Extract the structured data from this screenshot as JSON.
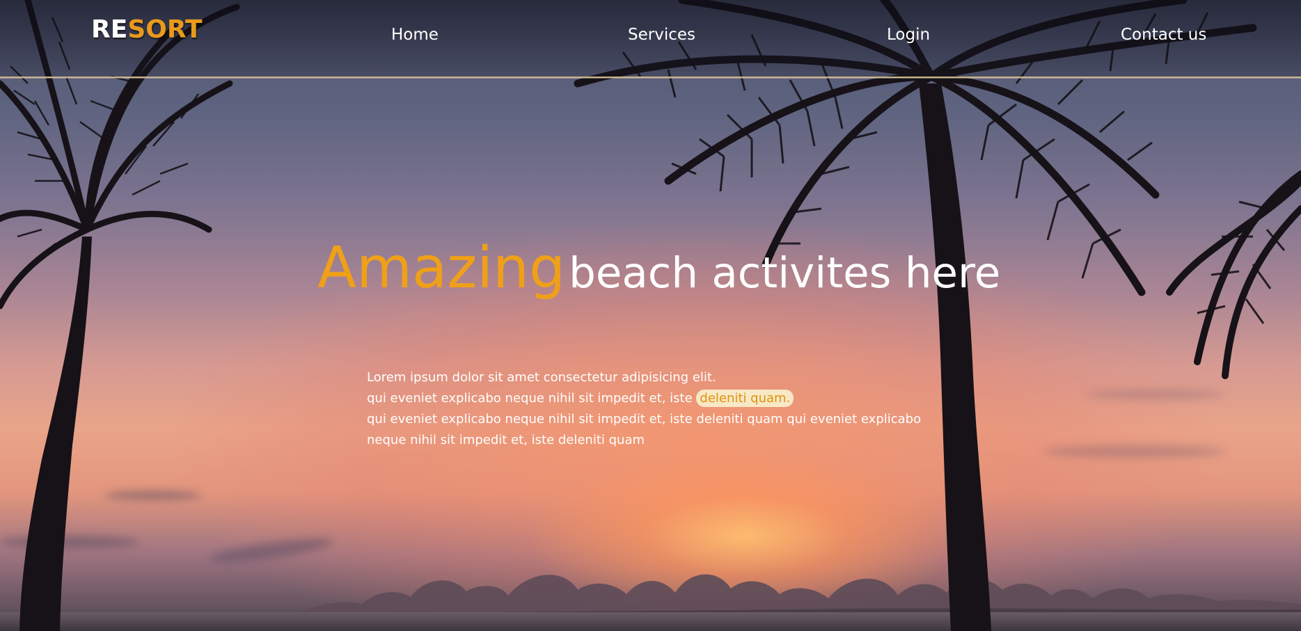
{
  "brand": {
    "part1": "RE",
    "part2": "SORT",
    "accent_color": "#e89a1c"
  },
  "nav": {
    "items": [
      {
        "label": "Home"
      },
      {
        "label": "Services"
      },
      {
        "label": "Login"
      },
      {
        "label": "Contact us"
      }
    ]
  },
  "hero": {
    "headline_accent": "Amazing",
    "headline_rest": "beach activites here",
    "accent_color": "#f0a018",
    "line1": "Lorem ipsum dolor sit amet consectetur adipisicing elit.",
    "line2_before": "qui eveniet explicabo neque nihil sit impedit et, iste ",
    "line2_highlight": "deleniti quam.",
    "line3": "qui eveniet explicabo neque nihil sit impedit et, iste deleniti quam qui eveniet explicabo",
    "line4": "neque nihil sit impedit et, iste deleniti quam"
  }
}
